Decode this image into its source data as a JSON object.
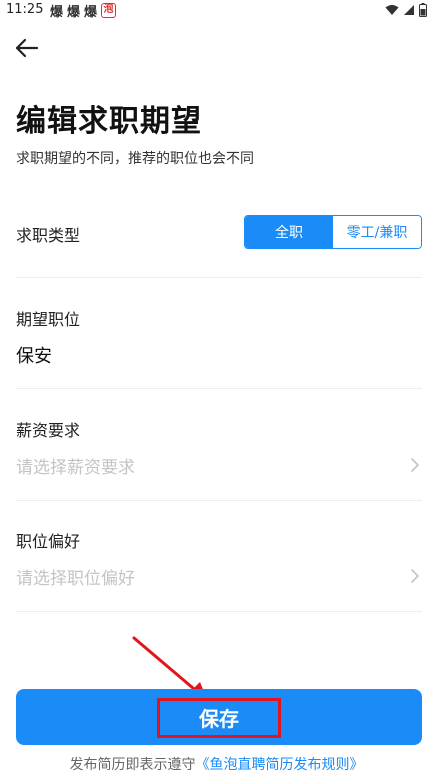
{
  "status_bar": {
    "time": "11:25",
    "app_icons": [
      "爆",
      "爆",
      "爆"
    ],
    "red_app_icon": "泡",
    "icons": [
      "wifi-icon",
      "signal-icon",
      "battery-icon"
    ]
  },
  "header": {
    "back_icon": "back-arrow-icon"
  },
  "page": {
    "title": "编辑求职期望",
    "subtitle": "求职期望的不同，推荐的职位也会不同"
  },
  "job_type": {
    "label": "求职类型",
    "options": [
      "全职",
      "零工/兼职"
    ],
    "selected": "全职"
  },
  "fields": [
    {
      "label": "期望职位",
      "value": "保安",
      "placeholder": ""
    },
    {
      "label": "薪资要求",
      "value": "",
      "placeholder": "请选择薪资要求"
    },
    {
      "label": "职位偏好",
      "value": "",
      "placeholder": "请选择职位偏好"
    }
  ],
  "save_button": {
    "label": "保存"
  },
  "footer": {
    "text": "发布简历即表示遵守",
    "link": "《鱼泡直聘简历发布规则》"
  },
  "colors": {
    "accent": "#1b8cf7",
    "annotation_red": "#e3141b",
    "placeholder": "#c4c4c4"
  }
}
